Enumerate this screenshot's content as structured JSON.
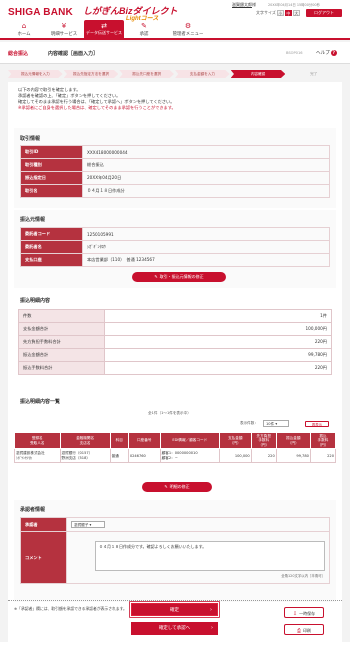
{
  "header": {
    "bank_name": "SHIGA BANK",
    "service_name": "しがぎんBizダイレクト",
    "service_sub": "Lightコース",
    "user_label": "滋賀銀太郎",
    "user_suffix": "様",
    "last_login": "20XX年04月14日 15時00分00秒",
    "font_size_label": "文字サイズ",
    "font_sizes": [
      "小",
      "中",
      "大"
    ],
    "logout_label": "ログアウト"
  },
  "nav": [
    {
      "icon": "home-icon",
      "glyph": "⌂",
      "label": "ホーム"
    },
    {
      "icon": "yen-icon",
      "glyph": "¥",
      "label": "明細サービス"
    },
    {
      "icon": "transfer-icon",
      "glyph": "⇄",
      "label": "データ伝送サービス"
    },
    {
      "icon": "approval-icon",
      "glyph": "✎",
      "label": "承認"
    },
    {
      "icon": "manage-icon",
      "glyph": "⚙",
      "label": "管理者メニュー"
    }
  ],
  "titlebar": {
    "category": "総合振込",
    "title": "内容確認［画面入力］",
    "screen_code": "BSOP016",
    "help_label": "ヘルプ",
    "help_glyph": "?"
  },
  "steps": [
    "振込元情報を入力",
    "振込先指定方法を選択",
    "振込先口座を選択",
    "支払金額を入力",
    "内容確認",
    "完了"
  ],
  "intro": {
    "line1": "以下の内容で取引を確定します。",
    "line2": "承認者を確認の上、「確定」ボタンを押してください。",
    "line3": "確定してそのまま承認を行う場合は、「確定して承認へ」ボタンを押してください。",
    "line4": "※承認者にご自身を選択した場合は、確定してそのまま承認を行うことができます。"
  },
  "transaction": {
    "title": "取引情報",
    "rows": [
      {
        "key": "取引ID",
        "value": "XXX418000000044"
      },
      {
        "key": "取引種別",
        "value": "総合振込"
      },
      {
        "key": "振込指定日",
        "value": "20XX年04月20日"
      },
      {
        "key": "取引名",
        "value": "０４月１８日作成分"
      }
    ]
  },
  "source": {
    "title": "振込元情報",
    "rows": [
      {
        "key": "委託者コード",
        "value": "1250105991"
      },
      {
        "key": "委託者名",
        "value": "ｼｶﾞｷﾞﾝﾀﾛｳ"
      },
      {
        "key": "支払口座",
        "value": "本店営業部（110）　普通 1234567"
      }
    ],
    "edit_label": "取引・振込元情報の修正"
  },
  "summary": {
    "title": "振込明細内容",
    "rows": [
      {
        "key": "件数",
        "value": "1件"
      },
      {
        "key": "支払金額合計",
        "value": "100,000円"
      },
      {
        "key": "先方負担手数料合計",
        "value": "220円"
      },
      {
        "key": "振込金額合計",
        "value": "99,780円"
      },
      {
        "key": "振込手数料合計",
        "value": "220円"
      }
    ]
  },
  "detail_list": {
    "title": "振込明細内容一覧",
    "count_line": "全1件（1〜1件を表示中）",
    "per_page_label": "表示件数：",
    "per_page_value": "10件",
    "redisplay_label": "再表示",
    "columns": [
      "登録名\n受取人名",
      "金融機関名\n支店名",
      "科目",
      "口座番号",
      "EDI情報／顧客コード",
      "支払金額\n（円）",
      "先方負担\n手数料\n（円）",
      "振込金額\n（円）",
      "振込\n手数料\n（円）"
    ],
    "rows": [
      {
        "registered_name": "滋賀建設株式会社",
        "payee": "ｼｶﾞｹﾝｾﾂ(ｶ",
        "bank": "滋賀銀行（0157）",
        "branch": "野洲支店（518）",
        "type": "普通",
        "account": "0246760",
        "edi1": "顧客1：0000000010",
        "edi2": "顧客2：−",
        "pay_amount": "100,000",
        "payee_fee": "220",
        "transfer_amount": "99,780",
        "fee": "220"
      }
    ],
    "edit_label": "明細の修正"
  },
  "approver": {
    "title": "承認者情報",
    "approver_label": "承認者",
    "approver_value": "滋賀銀子",
    "comment_label": "コメント",
    "comment_value": "０４月１８日作成分です。確認よろしくお願いいたします。",
    "char_count": "全角120文字以内［半角可］",
    "note": "※「承認者」欄には、取引額を承認できる承認者が表示されます。"
  },
  "actions": {
    "confirm_label": "確定",
    "confirm_approve_label": "確定して承認へ",
    "temp_save_label": "一時保存",
    "print_label": "印刷"
  }
}
